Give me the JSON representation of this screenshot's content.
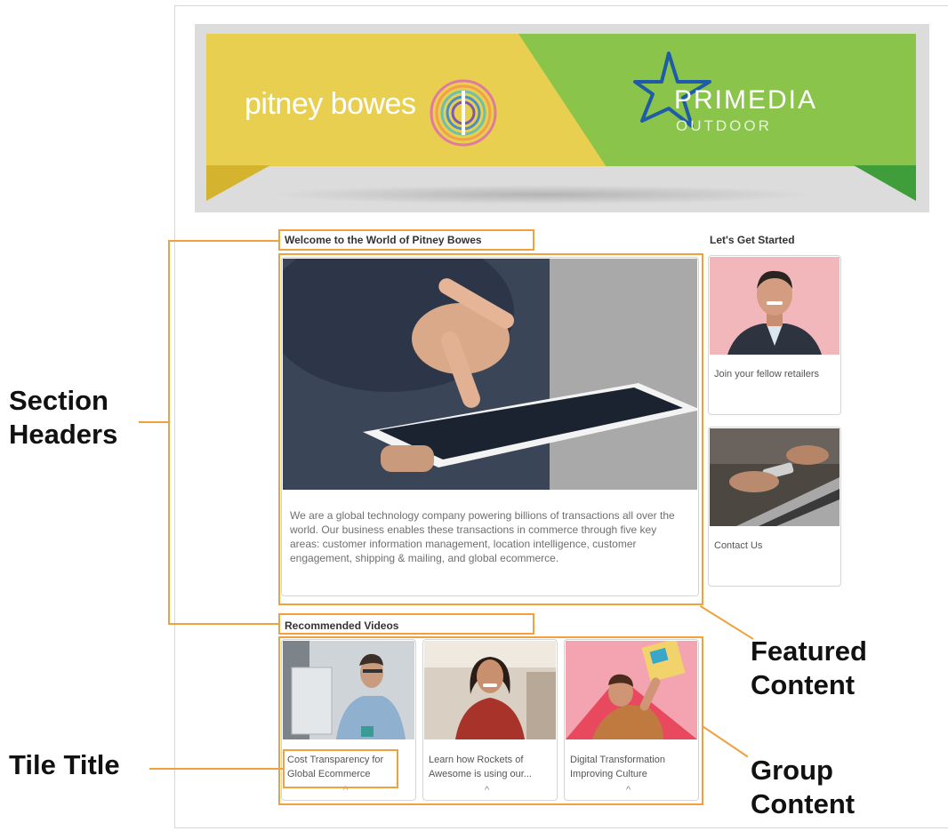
{
  "banner": {
    "left_brand": "pitney bowes",
    "right_brand": "PRIMEDIA",
    "right_brand_sub": "OUTDOOR"
  },
  "sections": {
    "welcome_header": "Welcome to the World of Pitney Bowes",
    "started_header": "Let's Get Started",
    "videos_header": "Recommended Videos"
  },
  "featured": {
    "description": "We are a global technology company powering billions of transactions all over the world. Our business enables these transactions in commerce through five key areas: customer information management, location intelligence, customer engagement, shipping & mailing, and global ecommerce."
  },
  "side_tiles": [
    {
      "label": "Join your fellow retailers"
    },
    {
      "label": "Contact Us"
    }
  ],
  "videos": [
    {
      "line1": "Cost Transparency for",
      "line2": "Global Ecommerce"
    },
    {
      "line1": "Learn how Rockets of",
      "line2": "Awesome is using our..."
    },
    {
      "line1": "Digital Transformation",
      "line2": "Improving Culture"
    }
  ],
  "annotations": {
    "section_headers_1": "Section",
    "section_headers_2": "Headers",
    "featured_1": "Featured",
    "featured_2": "Content",
    "tile_title": "Tile Title",
    "group_1": "Group",
    "group_2": "Content"
  },
  "colors": {
    "annotation_orange": "#f0a03c",
    "banner_yellow": "#e8cf4f",
    "banner_green": "#8bc44a"
  }
}
